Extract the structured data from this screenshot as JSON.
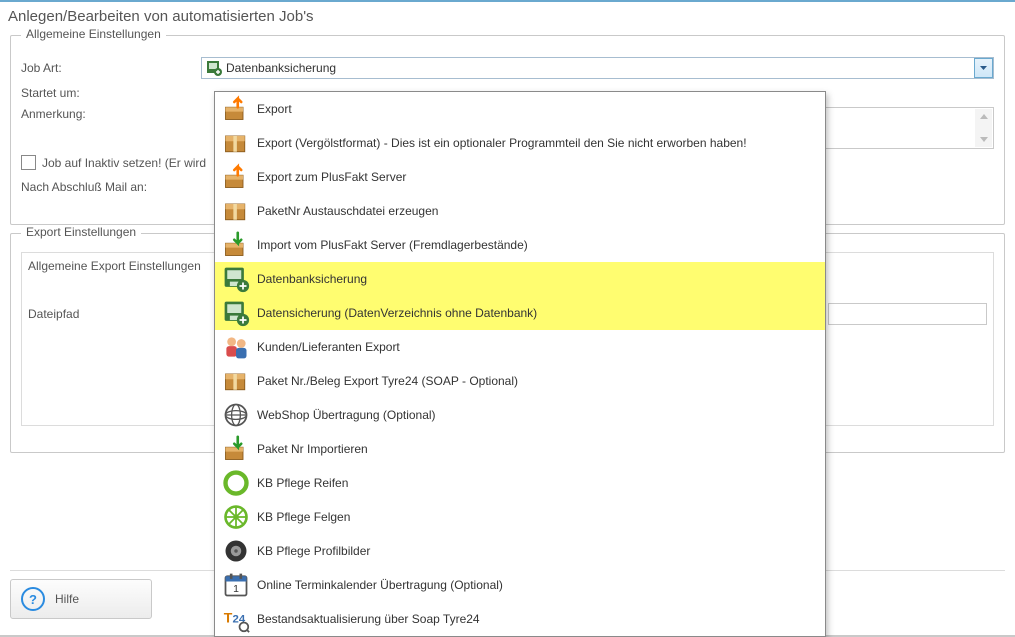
{
  "page_title": "Anlegen/Bearbeiten von automatisierten Job's",
  "groups": {
    "general": {
      "legend": "Allgemeine Einstellungen",
      "job_art_label": "Job Art:",
      "job_art_value": "Datenbanksicherung",
      "startet_label": "Startet um:",
      "anmerkung_label": "Anmerkung:",
      "inactive_checkbox": "Job auf Inaktiv setzen! (Er wird",
      "mail_label": "Nach Abschluß Mail an:"
    },
    "export": {
      "legend": "Export Einstellungen",
      "sub_title": "Allgemeine Export Einstellungen",
      "filepath_label": "Dateipfad"
    }
  },
  "help_button": "Hilfe",
  "dropdown_items": [
    {
      "label": "Export",
      "icon": "box-up-orange",
      "hl": false
    },
    {
      "label": "Export (Vergölstformat) - Dies ist ein optionaler Programmteil den Sie nicht erworben haben!",
      "icon": "box-closed",
      "hl": false
    },
    {
      "label": "Export zum PlusFakt Server",
      "icon": "box-up-orange",
      "hl": false
    },
    {
      "label": "PaketNr Austauschdatei erzeugen",
      "icon": "box-closed",
      "hl": false
    },
    {
      "label": "Import vom PlusFakt Server (Fremdlagerbestände)",
      "icon": "box-down-green",
      "hl": false
    },
    {
      "label": "Datenbanksicherung",
      "icon": "db-save",
      "hl": true
    },
    {
      "label": "Datensicherung (DatenVerzeichnis ohne Datenbank)",
      "icon": "db-save",
      "hl": true
    },
    {
      "label": "Kunden/Lieferanten Export",
      "icon": "people",
      "hl": false
    },
    {
      "label": "Paket Nr./Beleg Export Tyre24 (SOAP - Optional)",
      "icon": "box-closed",
      "hl": false
    },
    {
      "label": "WebShop Übertragung (Optional)",
      "icon": "globe",
      "hl": false
    },
    {
      "label": "Paket Nr Importieren",
      "icon": "box-down-green",
      "hl": false
    },
    {
      "label": "KB Pflege Reifen",
      "icon": "ring-green",
      "hl": false
    },
    {
      "label": "KB Pflege Felgen",
      "icon": "wheel-green",
      "hl": false
    },
    {
      "label": "KB Pflege Profilbilder",
      "icon": "tire-black",
      "hl": false
    },
    {
      "label": "Online Terminkalender Übertragung (Optional)",
      "icon": "calendar",
      "hl": false
    },
    {
      "label": "Bestandsaktualisierung über Soap Tyre24",
      "icon": "t24",
      "hl": false
    }
  ]
}
